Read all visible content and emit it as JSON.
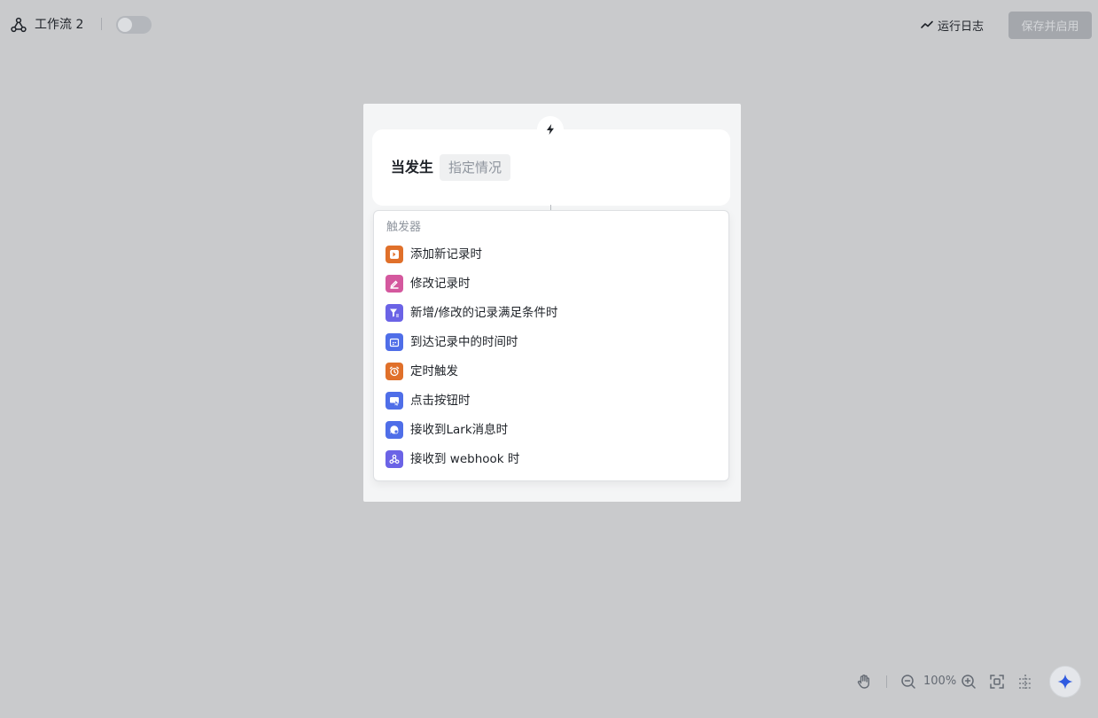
{
  "header": {
    "workflow_title": "工作流 2",
    "run_log_label": "运行日志",
    "save_enable_label": "保存并启用",
    "toggle_on": false
  },
  "trigger": {
    "when_label": "当发生",
    "condition_placeholder": "指定情况"
  },
  "dropdown": {
    "heading": "触发器",
    "items": [
      {
        "label": "添加新记录时",
        "icon": "add-record-icon",
        "color": "#e0702a"
      },
      {
        "label": "修改记录时",
        "icon": "edit-record-icon",
        "color": "#d4589e"
      },
      {
        "label": "新增/修改的记录满足条件时",
        "icon": "filter-icon",
        "color": "#6b63e6"
      },
      {
        "label": "到达记录中的时间时",
        "icon": "calendar-icon",
        "color": "#4f6ee8"
      },
      {
        "label": "定时触发",
        "icon": "alarm-clock-icon",
        "color": "#e0702a"
      },
      {
        "label": "点击按钮时",
        "icon": "click-button-icon",
        "color": "#4f6ee8"
      },
      {
        "label": "接收到Lark消息时",
        "icon": "message-icon",
        "color": "#4f6ee8"
      },
      {
        "label": "接收到 webhook 时",
        "icon": "webhook-icon",
        "color": "#6b63e6"
      }
    ]
  },
  "canvas_controls": {
    "zoom_level": "100%"
  }
}
